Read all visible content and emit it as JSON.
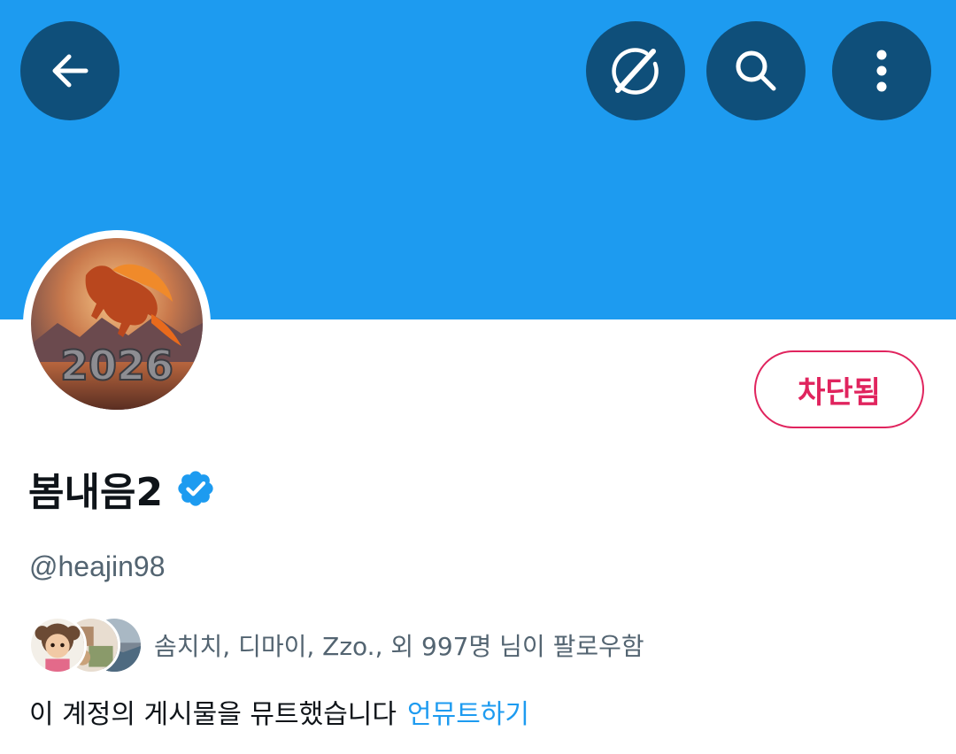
{
  "header": {
    "back_icon": "arrow-left-icon",
    "grok_icon": "grok-icon",
    "search_icon": "search-icon",
    "more_icon": "more-vertical-icon",
    "banner_color": "#1d9bf0",
    "button_color": "#0f4f7a"
  },
  "profile": {
    "avatar_text": "2026",
    "display_name": "봄내음2",
    "verified_icon": "verified-badge-icon",
    "handle": "@heajin98",
    "block_button_label": "차단됨",
    "block_color": "#e0245e"
  },
  "followers": {
    "summary": "솜치치, 디마이, Zzo., 외 997명 님이 팔로우함"
  },
  "mute": {
    "message": "이 계정의 게시물을 뮤트했습니다",
    "unmute_label": "언뮤트하기",
    "link_color": "#1d9bf0"
  }
}
